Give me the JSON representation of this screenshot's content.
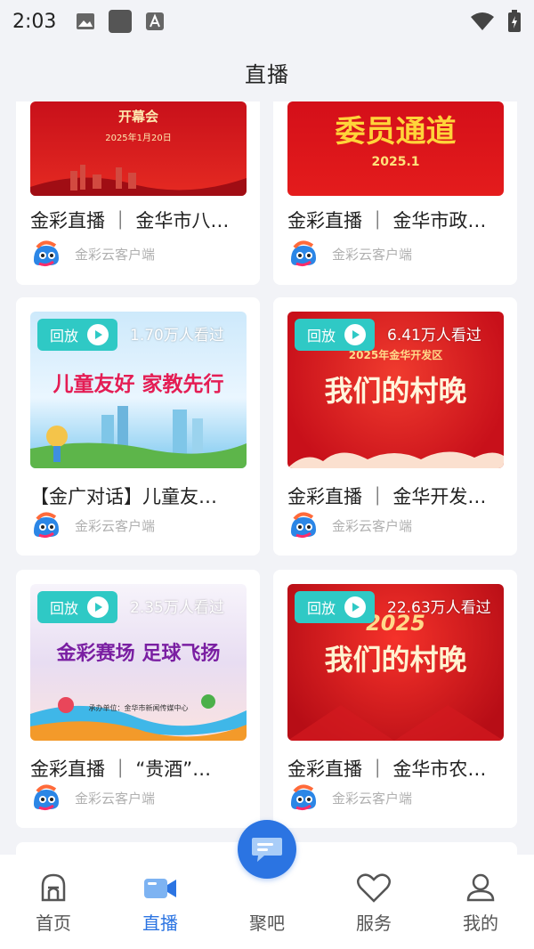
{
  "status_bar": {
    "time": "2:03"
  },
  "header": {
    "title": "直播"
  },
  "source_label": "金彩云客户端",
  "badge_label": "回放",
  "cards": [
    {
      "title": "金彩直播 ｜ 金华市八…",
      "poster_title": "开幕会",
      "poster_sub": "2025年1月20日"
    },
    {
      "title": "金彩直播 ｜ 金华市政…",
      "poster_title": "委员通道",
      "poster_sub": "2025.1"
    },
    {
      "title": "【金广对话】儿童友…",
      "viewers": "1.70万人看过",
      "poster_title": "儿童友好 家教先行"
    },
    {
      "title": "金彩直播 ｜ 金华开发…",
      "viewers": "6.41万人看过",
      "poster_sub": "2025年金华开发区",
      "poster_title": "我们的村晚"
    },
    {
      "title": "金彩直播 ｜ “贵酒”…",
      "viewers": "2.35万人看过",
      "poster_title": "金彩赛场 足球飞扬",
      "poster_sub": "承办单位：金华市新闻传媒中心"
    },
    {
      "title": "金彩直播 ｜ 金华市农…",
      "viewers": "22.63万人看过",
      "poster_sub": "2025",
      "poster_title": "我们的村晚"
    }
  ],
  "tabs": [
    {
      "label": "首页",
      "icon": "home-icon"
    },
    {
      "label": "直播",
      "icon": "video-icon",
      "active": true
    },
    {
      "label": "聚吧",
      "icon": "chat-icon"
    },
    {
      "label": "服务",
      "icon": "heart-icon"
    },
    {
      "label": "我的",
      "icon": "user-icon"
    }
  ],
  "colors": {
    "accent": "#2b74e2",
    "badge": "#2fc9c5",
    "poster_red": "#d8141e"
  }
}
